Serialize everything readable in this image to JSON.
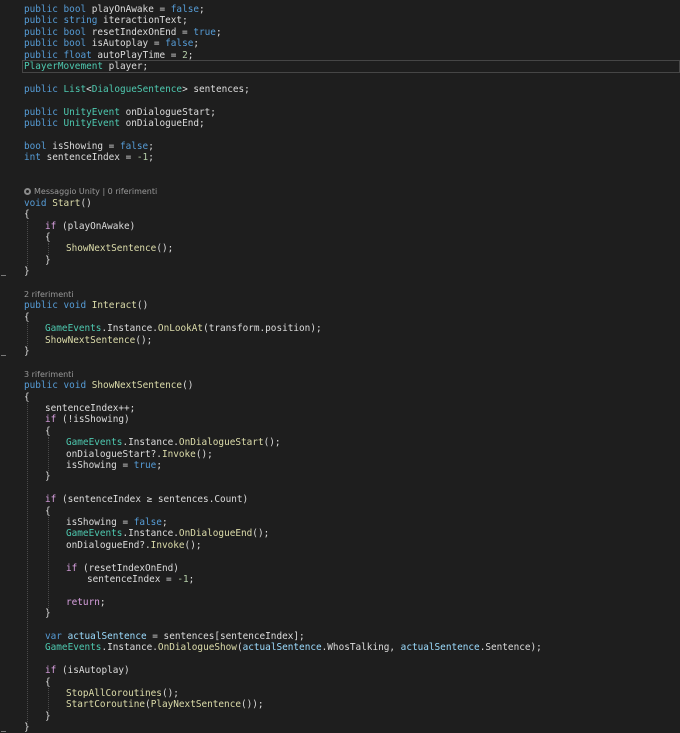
{
  "editor": {
    "language": "C#",
    "colors": {
      "background": "#1e1e1e",
      "keyword": "#569cd6",
      "type": "#4ec9b0",
      "method": "#dcdcaa",
      "number": "#b5cea8",
      "control": "#d8a0df",
      "variable": "#9cdcfe",
      "codelens": "#999999",
      "plain": "#dcdcdc"
    },
    "lines": [
      {
        "indent": 1,
        "tokens": [
          [
            "kw",
            "public"
          ],
          [
            "p",
            " "
          ],
          [
            "kw",
            "bool"
          ],
          [
            "p",
            " playOnAwake = "
          ],
          [
            "kw",
            "false"
          ],
          [
            "p",
            ";"
          ]
        ]
      },
      {
        "indent": 1,
        "tokens": [
          [
            "kw",
            "public"
          ],
          [
            "p",
            " "
          ],
          [
            "kw",
            "string"
          ],
          [
            "p",
            " iteractionText;"
          ]
        ]
      },
      {
        "indent": 1,
        "tokens": [
          [
            "kw",
            "public"
          ],
          [
            "p",
            " "
          ],
          [
            "kw",
            "bool"
          ],
          [
            "p",
            " resetIndexOnEnd = "
          ],
          [
            "kw",
            "true"
          ],
          [
            "p",
            ";"
          ]
        ]
      },
      {
        "indent": 1,
        "tokens": [
          [
            "kw",
            "public"
          ],
          [
            "p",
            " "
          ],
          [
            "kw",
            "bool"
          ],
          [
            "p",
            " isAutoplay = "
          ],
          [
            "kw",
            "false"
          ],
          [
            "p",
            ";"
          ]
        ]
      },
      {
        "indent": 1,
        "tokens": [
          [
            "kw",
            "public"
          ],
          [
            "p",
            " "
          ],
          [
            "kw",
            "float"
          ],
          [
            "p",
            " autoPlayTime = "
          ],
          [
            "num",
            "2"
          ],
          [
            "p",
            ";"
          ]
        ]
      },
      {
        "indent": 1,
        "current": true,
        "tokens": [
          [
            "type",
            "PlayerMovement"
          ],
          [
            "p",
            " player;"
          ]
        ]
      },
      {
        "blank": true
      },
      {
        "indent": 1,
        "tokens": [
          [
            "kw",
            "public"
          ],
          [
            "p",
            " "
          ],
          [
            "type",
            "List"
          ],
          [
            "p",
            "<"
          ],
          [
            "type",
            "DialogueSentence"
          ],
          [
            "p",
            "> sentences;"
          ]
        ]
      },
      {
        "blank": true
      },
      {
        "indent": 1,
        "tokens": [
          [
            "kw",
            "public"
          ],
          [
            "p",
            " "
          ],
          [
            "type",
            "UnityEvent"
          ],
          [
            "p",
            " onDialogueStart;"
          ]
        ]
      },
      {
        "indent": 1,
        "tokens": [
          [
            "kw",
            "public"
          ],
          [
            "p",
            " "
          ],
          [
            "type",
            "UnityEvent"
          ],
          [
            "p",
            " onDialogueEnd;"
          ]
        ]
      },
      {
        "blank": true
      },
      {
        "indent": 1,
        "tokens": [
          [
            "kw",
            "bool"
          ],
          [
            "p",
            " isShowing = "
          ],
          [
            "kw",
            "false"
          ],
          [
            "p",
            ";"
          ]
        ]
      },
      {
        "indent": 1,
        "tokens": [
          [
            "kw",
            "int"
          ],
          [
            "p",
            " sentenceIndex = "
          ],
          [
            "num",
            "-1"
          ],
          [
            "p",
            ";"
          ]
        ]
      },
      {
        "blank": true
      },
      {
        "blank": true
      },
      {
        "indent": 1,
        "lens": true,
        "icon": "unity-message-icon",
        "text": "Messaggio Unity | 0 riferimenti"
      },
      {
        "indent": 1,
        "tokens": [
          [
            "kw",
            "void"
          ],
          [
            "p",
            " "
          ],
          [
            "method",
            "Start"
          ],
          [
            "p",
            "()"
          ]
        ]
      },
      {
        "indent": 1,
        "tokens": [
          [
            "p",
            "{"
          ]
        ]
      },
      {
        "indent": 2,
        "tokens": [
          [
            "ctl",
            "if"
          ],
          [
            "p",
            " (playOnAwake)"
          ]
        ]
      },
      {
        "indent": 2,
        "tokens": [
          [
            "p",
            "{"
          ]
        ]
      },
      {
        "indent": 3,
        "tokens": [
          [
            "method",
            "ShowNextSentence"
          ],
          [
            "p",
            "();"
          ]
        ]
      },
      {
        "indent": 2,
        "tokens": [
          [
            "p",
            "}"
          ]
        ]
      },
      {
        "indent": 1,
        "tokens": [
          [
            "p",
            "}"
          ]
        ]
      },
      {
        "blank": true
      },
      {
        "indent": 1,
        "lens": true,
        "text": "2 riferimenti"
      },
      {
        "indent": 1,
        "tokens": [
          [
            "kw",
            "public"
          ],
          [
            "p",
            " "
          ],
          [
            "kw",
            "void"
          ],
          [
            "p",
            " "
          ],
          [
            "method",
            "Interact"
          ],
          [
            "p",
            "()"
          ]
        ]
      },
      {
        "indent": 1,
        "tokens": [
          [
            "p",
            "{"
          ]
        ]
      },
      {
        "indent": 2,
        "tokens": [
          [
            "type",
            "GameEvents"
          ],
          [
            "p",
            "."
          ],
          [
            "p",
            "Instance"
          ],
          [
            "p",
            "."
          ],
          [
            "method",
            "OnLookAt"
          ],
          [
            "p",
            "(transform.position);"
          ]
        ]
      },
      {
        "indent": 2,
        "tokens": [
          [
            "method",
            "ShowNextSentence"
          ],
          [
            "p",
            "();"
          ]
        ]
      },
      {
        "indent": 1,
        "tokens": [
          [
            "p",
            "}"
          ]
        ]
      },
      {
        "blank": true
      },
      {
        "indent": 1,
        "lens": true,
        "text": "3 riferimenti"
      },
      {
        "indent": 1,
        "tokens": [
          [
            "kw",
            "public"
          ],
          [
            "p",
            " "
          ],
          [
            "kw",
            "void"
          ],
          [
            "p",
            " "
          ],
          [
            "method",
            "ShowNextSentence"
          ],
          [
            "p",
            "()"
          ]
        ]
      },
      {
        "indent": 1,
        "tokens": [
          [
            "p",
            "{"
          ]
        ]
      },
      {
        "indent": 2,
        "tokens": [
          [
            "p",
            "sentenceIndex++;"
          ]
        ]
      },
      {
        "indent": 2,
        "tokens": [
          [
            "ctl",
            "if"
          ],
          [
            "p",
            " (!isShowing)"
          ]
        ]
      },
      {
        "indent": 2,
        "tokens": [
          [
            "p",
            "{"
          ]
        ]
      },
      {
        "indent": 3,
        "tokens": [
          [
            "type",
            "GameEvents"
          ],
          [
            "p",
            "."
          ],
          [
            "p",
            "Instance"
          ],
          [
            "p",
            "."
          ],
          [
            "method",
            "OnDialogueStart"
          ],
          [
            "p",
            "();"
          ]
        ]
      },
      {
        "indent": 3,
        "tokens": [
          [
            "p",
            "onDialogueStart?."
          ],
          [
            "method",
            "Invoke"
          ],
          [
            "p",
            "();"
          ]
        ]
      },
      {
        "indent": 3,
        "tokens": [
          [
            "p",
            "isShowing = "
          ],
          [
            "kw",
            "true"
          ],
          [
            "p",
            ";"
          ]
        ]
      },
      {
        "indent": 2,
        "tokens": [
          [
            "p",
            "}"
          ]
        ]
      },
      {
        "blank": true
      },
      {
        "indent": 2,
        "tokens": [
          [
            "ctl",
            "if"
          ],
          [
            "p",
            " (sentenceIndex ≥ sentences.Count)"
          ]
        ]
      },
      {
        "indent": 2,
        "tokens": [
          [
            "p",
            "{"
          ]
        ]
      },
      {
        "indent": 3,
        "tokens": [
          [
            "p",
            "isShowing = "
          ],
          [
            "kw",
            "false"
          ],
          [
            "p",
            ";"
          ]
        ]
      },
      {
        "indent": 3,
        "tokens": [
          [
            "type",
            "GameEvents"
          ],
          [
            "p",
            "."
          ],
          [
            "p",
            "Instance"
          ],
          [
            "p",
            "."
          ],
          [
            "method",
            "OnDialogueEnd"
          ],
          [
            "p",
            "();"
          ]
        ]
      },
      {
        "indent": 3,
        "tokens": [
          [
            "p",
            "onDialogueEnd?."
          ],
          [
            "method",
            "Invoke"
          ],
          [
            "p",
            "();"
          ]
        ]
      },
      {
        "blank": true
      },
      {
        "indent": 3,
        "tokens": [
          [
            "ctl",
            "if"
          ],
          [
            "p",
            " (resetIndexOnEnd)"
          ]
        ]
      },
      {
        "indent": 4,
        "tokens": [
          [
            "p",
            "sentenceIndex = "
          ],
          [
            "num",
            "-1"
          ],
          [
            "p",
            ";"
          ]
        ]
      },
      {
        "blank": true
      },
      {
        "indent": 3,
        "tokens": [
          [
            "ctl",
            "return"
          ],
          [
            "p",
            ";"
          ]
        ]
      },
      {
        "indent": 2,
        "tokens": [
          [
            "p",
            "}"
          ]
        ]
      },
      {
        "blank": true
      },
      {
        "indent": 2,
        "tokens": [
          [
            "kw",
            "var"
          ],
          [
            "p",
            " "
          ],
          [
            "var",
            "actualSentence"
          ],
          [
            "p",
            " = sentences[sentenceIndex];"
          ]
        ]
      },
      {
        "indent": 2,
        "tokens": [
          [
            "type",
            "GameEvents"
          ],
          [
            "p",
            "."
          ],
          [
            "p",
            "Instance"
          ],
          [
            "p",
            "."
          ],
          [
            "method",
            "OnDialogueShow"
          ],
          [
            "p",
            "("
          ],
          [
            "var",
            "actualSentence"
          ],
          [
            "p",
            ".WhosTalking, "
          ],
          [
            "var",
            "actualSentence"
          ],
          [
            "p",
            ".Sentence);"
          ]
        ]
      },
      {
        "blank": true
      },
      {
        "indent": 2,
        "tokens": [
          [
            "ctl",
            "if"
          ],
          [
            "p",
            " (isAutoplay)"
          ]
        ]
      },
      {
        "indent": 2,
        "tokens": [
          [
            "p",
            "{"
          ]
        ]
      },
      {
        "indent": 3,
        "tokens": [
          [
            "method",
            "StopAllCoroutines"
          ],
          [
            "p",
            "();"
          ]
        ]
      },
      {
        "indent": 3,
        "tokens": [
          [
            "method",
            "StartCoroutine"
          ],
          [
            "p",
            "("
          ],
          [
            "method",
            "PlayNextSentence"
          ],
          [
            "p",
            "());"
          ]
        ]
      },
      {
        "indent": 2,
        "tokens": [
          [
            "p",
            "}"
          ]
        ]
      },
      {
        "indent": 1,
        "tokens": [
          [
            "p",
            "}"
          ]
        ]
      }
    ]
  }
}
